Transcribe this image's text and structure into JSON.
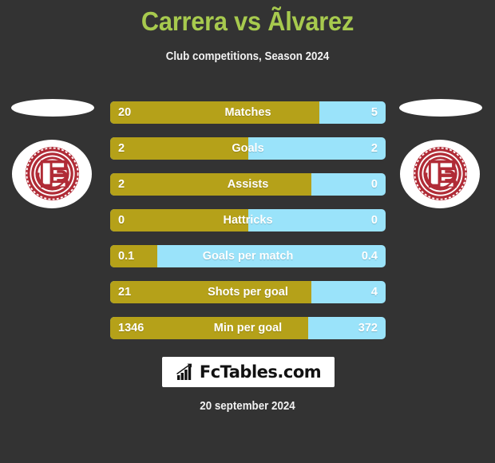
{
  "header": {
    "title": "Carrera vs Ãlvarez",
    "subtitle": "Club competitions, Season 2024"
  },
  "colors": {
    "background": "#333333",
    "title": "#a7ca4e",
    "home_bar": "#b5a119",
    "away_bar": "#9ae3fa",
    "crest_red": "#b02b36",
    "text": "#ffffff"
  },
  "crests": {
    "left_alt": "Club Atletico Lanus crest",
    "right_alt": "Club Atletico Lanus crest"
  },
  "chart_data": {
    "type": "bar",
    "title": "Carrera vs Ãlvarez",
    "subtitle": "Club competitions, Season 2024",
    "categories": [
      "Matches",
      "Goals",
      "Assists",
      "Hattricks",
      "Goals per match",
      "Shots per goal",
      "Min per goal"
    ],
    "series": [
      {
        "name": "Carrera",
        "values": [
          "20",
          "2",
          "2",
          "0",
          "0.1",
          "21",
          "1346"
        ]
      },
      {
        "name": "Ãlvarez",
        "values": [
          "5",
          "2",
          "0",
          "0",
          "0.4",
          "4",
          "372"
        ]
      }
    ],
    "legend": "none",
    "grid": false
  },
  "stats": [
    {
      "label": "Matches",
      "left": "20",
      "right": "5",
      "left_pct": 76
    },
    {
      "label": "Goals",
      "left": "2",
      "right": "2",
      "left_pct": 50
    },
    {
      "label": "Assists",
      "left": "2",
      "right": "0",
      "left_pct": 73
    },
    {
      "label": "Hattricks",
      "left": "0",
      "right": "0",
      "left_pct": 50
    },
    {
      "label": "Goals per match",
      "left": "0.1",
      "right": "0.4",
      "left_pct": 17
    },
    {
      "label": "Shots per goal",
      "left": "21",
      "right": "4",
      "left_pct": 73
    },
    {
      "label": "Min per goal",
      "left": "1346",
      "right": "372",
      "left_pct": 72
    }
  ],
  "footer": {
    "logo_text": "FcTables.com",
    "logo_icon": "bar-chart-growth-icon",
    "date": "20 september 2024"
  }
}
